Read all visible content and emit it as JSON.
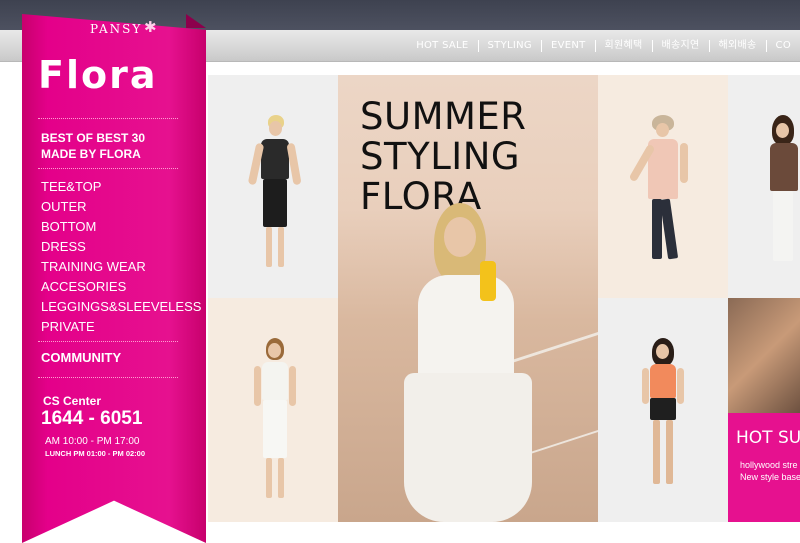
{
  "nav": {
    "items": [
      "HOT SALE",
      "STYLING",
      "EVENT",
      "회원혜택",
      "배송지연",
      "해외배송",
      "CO"
    ]
  },
  "logo": {
    "brand_small": "PANSY",
    "brand_main": "Flora",
    "star_icon": "asterisk-flower-icon"
  },
  "sidebar": {
    "best_line1": "BEST OF BEST 30",
    "best_line2": "MADE BY FLORA",
    "categories": [
      "TEE&TOP",
      "OUTER",
      "BOTTOM",
      "DRESS",
      "TRAINING WEAR",
      "ACCESORIES",
      "LEGGINGS&SLEEVELESS",
      "PRIVATE"
    ],
    "community": "COMMUNITY",
    "cs_label": "CS Center",
    "cs_phone": "1644 - 6051",
    "cs_hours": "AM 10:00 - PM 17:00",
    "cs_lunch": "LUNCH  PM 01:00 - PM 02:00"
  },
  "hero": {
    "line1": "SUMMER",
    "line2": "STYLING",
    "line3": "FLORA"
  },
  "hot": {
    "title": "HOT SUM",
    "sub1": "hollywood stre",
    "sub2": "New style base"
  },
  "colors": {
    "brand_pink": "#e6118f",
    "topbar": "#444856"
  }
}
